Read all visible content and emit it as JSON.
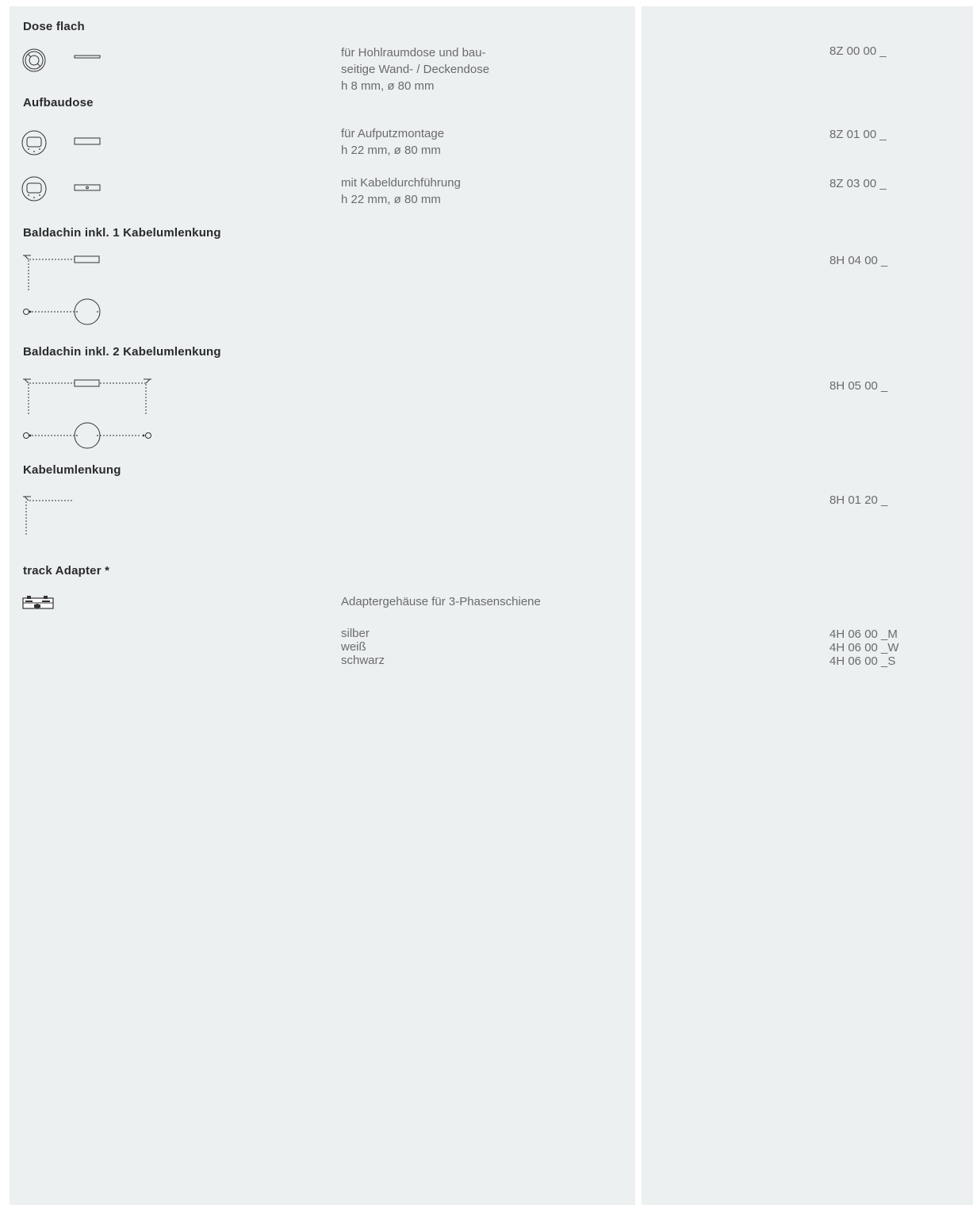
{
  "sections": [
    {
      "heading": "Dose flach",
      "items": [
        {
          "desc_lines": [
            "für Hohlraumdose und bau-",
            "seitige Wand- / Deckendose",
            "h  8 mm, ø 80 mm"
          ],
          "code": "8Z 00 00 _"
        }
      ]
    },
    {
      "heading": "Aufbaudose",
      "items": [
        {
          "desc_lines": [
            "für Aufputzmontage",
            "h  22 mm, ø 80 mm"
          ],
          "code": "8Z 01 00 _"
        },
        {
          "desc_lines": [
            "mit Kabeldurchführung",
            "h  22 mm, ø 80 mm"
          ],
          "code": "8Z 03 00 _"
        }
      ]
    },
    {
      "heading": "Baldachin inkl. 1 Kabelumlenkung",
      "items": [
        {
          "code": "8H 04 00 _"
        }
      ]
    },
    {
      "heading": "Baldachin inkl. 2 Kabelumlenkung",
      "items": [
        {
          "code": "8H 05 00 _"
        }
      ]
    },
    {
      "heading": "Kabelumlenkung",
      "items": [
        {
          "code": "8H 01 20 _"
        }
      ]
    },
    {
      "heading": "track Adapter *",
      "items": [
        {
          "desc_lines": [
            "Adaptergehäuse für 3-Phasenschiene"
          ]
        },
        {
          "desc_lines": [
            "silber",
            "weiß",
            "schwarz"
          ],
          "code_lines": [
            "4H 06 00 _M",
            "4H 06 00 _W",
            "4H 06 00 _S"
          ]
        }
      ]
    }
  ],
  "icons": {
    "dose_flach": "flat-box-drawing-icon",
    "aufbaudose_1": "surface-box-drawing-icon",
    "aufbaudose_2": "surface-box-cable-entry-drawing-icon",
    "baldachin_1": "canopy-1-cable-diversion-drawing-icon",
    "baldachin_2": "canopy-2-cable-diversion-drawing-icon",
    "kabelumlenkung": "cable-diversion-drawing-icon",
    "track_adapter": "track-adapter-housing-icon"
  },
  "colors": {
    "panel_background": "#ecf0f1",
    "heading_text": "#2a2a2a",
    "body_text": "#6b6b6b"
  }
}
